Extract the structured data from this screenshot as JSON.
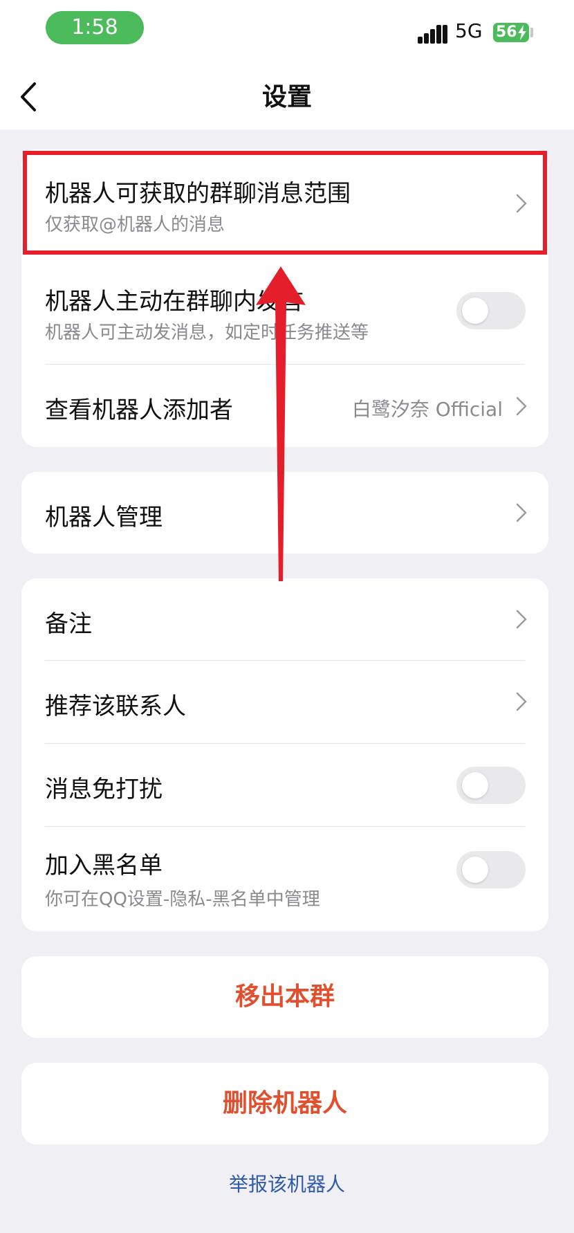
{
  "status_bar": {
    "time": "1:58",
    "network": "5G",
    "battery": "56"
  },
  "nav": {
    "title": "设置"
  },
  "group1": {
    "message_scope": {
      "title": "机器人可获取的群聊消息范围",
      "subtitle": "仅获取@机器人的消息"
    },
    "proactive_speak": {
      "title": "机器人主动在群聊内发言",
      "subtitle": "机器人可主动发消息，如定时任务推送等",
      "enabled": false
    },
    "view_adder": {
      "title": "查看机器人添加者",
      "value": "白鹭汐奈 Official"
    }
  },
  "group2": {
    "bot_manage": {
      "title": "机器人管理"
    }
  },
  "group3": {
    "remark": {
      "title": "备注"
    },
    "recommend": {
      "title": "推荐该联系人"
    },
    "do_not_disturb": {
      "title": "消息免打扰",
      "enabled": false
    },
    "blacklist": {
      "title": "加入黑名单",
      "subtitle": "你可在QQ设置-隐私-黑名单中管理",
      "enabled": false
    }
  },
  "actions": {
    "remove_from_group": "移出本群",
    "delete_bot": "删除机器人",
    "report_bot": "举报该机器人"
  },
  "colors": {
    "accent_green": "#4cbb5b",
    "danger": "#e0502e",
    "link": "#2f5aa8",
    "annotation_red": "#e41e2b"
  }
}
